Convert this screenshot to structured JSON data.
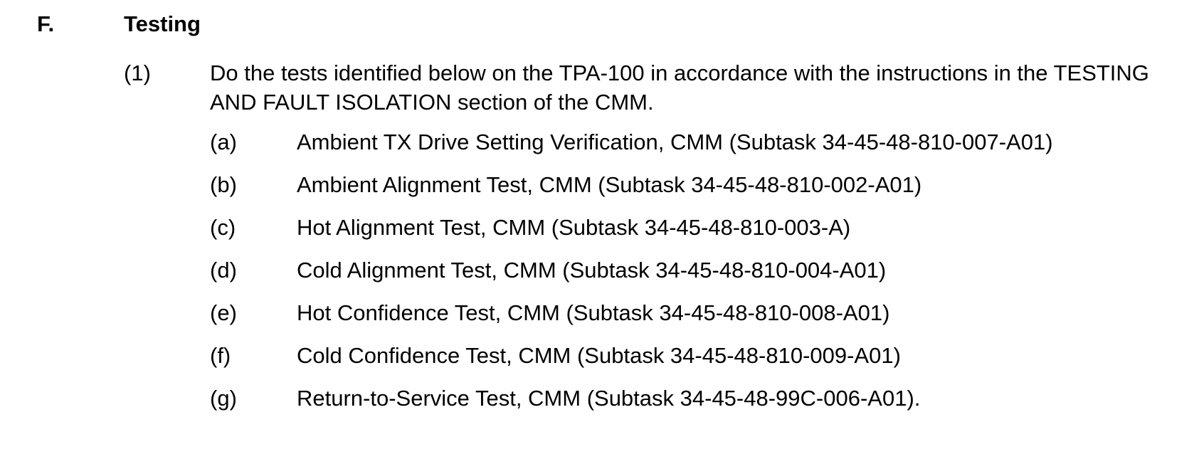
{
  "section": {
    "letter": "F.",
    "title": "Testing"
  },
  "paragraph": {
    "number": "(1)",
    "text": "Do the tests identified below on the TPA-100 in accordance with the instructions in the TESTING AND FAULT ISOLATION section of the CMM."
  },
  "items": [
    {
      "label": "(a)",
      "text": "Ambient TX Drive Setting Verification, CMM (Subtask 34-45-48-810-007-A01)"
    },
    {
      "label": "(b)",
      "text": "Ambient Alignment Test, CMM (Subtask 34-45-48-810-002-A01)"
    },
    {
      "label": "(c)",
      "text": "Hot Alignment Test, CMM (Subtask 34-45-48-810-003-A)"
    },
    {
      "label": "(d)",
      "text": "Cold Alignment Test, CMM (Subtask 34-45-48-810-004-A01)"
    },
    {
      "label": "(e)",
      "text": "Hot Confidence Test, CMM (Subtask 34-45-48-810-008-A01)"
    },
    {
      "label": "(f)",
      "text": "Cold Confidence Test, CMM (Subtask 34-45-48-810-009-A01)"
    },
    {
      "label": "(g)",
      "text": "Return-to-Service Test, CMM (Subtask 34-45-48-99C-006-A01)."
    }
  ]
}
